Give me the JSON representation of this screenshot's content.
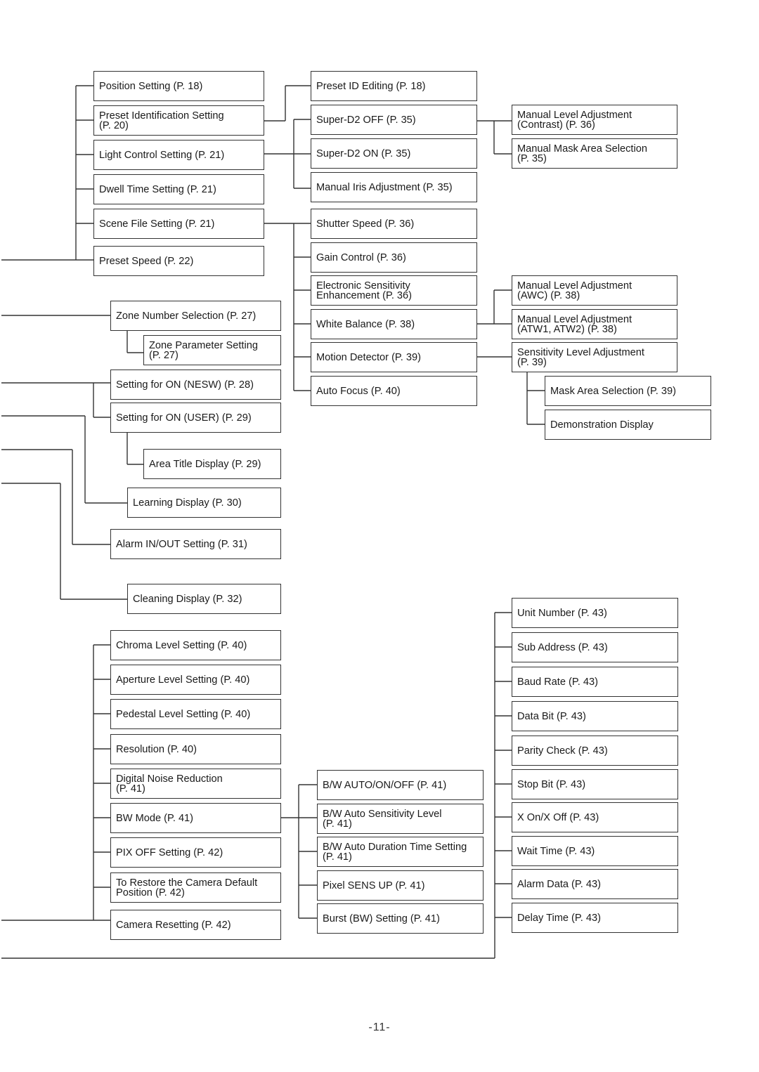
{
  "page_number": "-11-",
  "boxes": {
    "position_setting": "Position Setting (P. 18)",
    "preset_identification_setting": "Preset Identification Setting\n(P. 20)",
    "light_control_setting": "Light Control Setting (P. 21)",
    "dwell_time_setting": "Dwell Time Setting (P. 21)",
    "scene_file_setting": "Scene File Setting (P. 21)",
    "preset_speed": "Preset Speed (P. 22)",
    "preset_id_editing": "Preset ID Editing (P. 18)",
    "super_d2_off": "Super-D2 OFF (P. 35)",
    "super_d2_on": "Super-D2 ON (P. 35)",
    "manual_iris_adjustment": "Manual Iris Adjustment (P. 35)",
    "manual_level_contrast": "Manual Level Adjustment\n(Contrast) (P. 36)",
    "manual_mask_area_selection": "Manual Mask Area Selection\n(P. 35)",
    "shutter_speed": "Shutter Speed (P. 36)",
    "gain_control": "Gain Control (P. 36)",
    "electronic_sensitivity": "Electronic Sensitivity\nEnhancement (P. 36)",
    "white_balance": "White Balance (P. 38)",
    "motion_detector": "Motion Detector (P. 39)",
    "auto_focus": "Auto Focus (P. 40)",
    "manual_level_awc": "Manual Level Adjustment\n(AWC) (P. 38)",
    "manual_level_atw": "Manual Level Adjustment\n(ATW1, ATW2) (P. 38)",
    "sensitivity_level_adjustment": "Sensitivity Level Adjustment\n(P. 39)",
    "mask_area_selection": "Mask Area Selection (P. 39)",
    "demonstration_display": "Demonstration Display",
    "zone_number_selection": "Zone Number Selection (P. 27)",
    "zone_parameter_setting": "Zone Parameter Setting\n(P. 27)",
    "setting_on_nesw": "Setting for ON (NESW) (P. 28)",
    "setting_on_user": "Setting for ON (USER) (P. 29)",
    "area_title_display": "Area Title Display (P. 29)",
    "learning_display": "Learning Display (P. 30)",
    "alarm_in_out_setting": "Alarm IN/OUT Setting (P. 31)",
    "cleaning_display": "Cleaning Display (P. 32)",
    "chroma_level_setting": "Chroma Level Setting (P. 40)",
    "aperture_level_setting": "Aperture Level Setting (P. 40)",
    "pedestal_level_setting": "Pedestal Level Setting (P. 40)",
    "resolution": "Resolution (P. 40)",
    "digital_noise_reduction": "Digital Noise Reduction\n(P. 41)",
    "bw_mode": "BW Mode (P. 41)",
    "pix_off_setting": "PIX OFF Setting (P. 42)",
    "restore_camera_default": "To Restore the Camera Default\nPosition (P. 42)",
    "camera_resetting": "Camera Resetting (P. 42)",
    "bw_auto_on_off": "B/W AUTO/ON/OFF (P. 41)",
    "bw_auto_sensitivity_level": "B/W Auto Sensitivity Level\n(P. 41)",
    "bw_auto_duration_time": "B/W Auto Duration Time Setting\n(P. 41)",
    "pixel_sens_up": "Pixel SENS UP (P. 41)",
    "burst_bw_setting": "Burst (BW) Setting (P. 41)",
    "unit_number": "Unit Number (P. 43)",
    "sub_address": "Sub Address (P. 43)",
    "baud_rate": "Baud Rate (P. 43)",
    "data_bit": "Data Bit (P. 43)",
    "parity_check": "Parity Check (P. 43)",
    "stop_bit": "Stop Bit (P. 43)",
    "x_on_x_off": "X On/X Off (P. 43)",
    "wait_time": "Wait Time (P. 43)",
    "alarm_data": "Alarm Data (P. 43)",
    "delay_time": "Delay Time (P. 43)"
  }
}
